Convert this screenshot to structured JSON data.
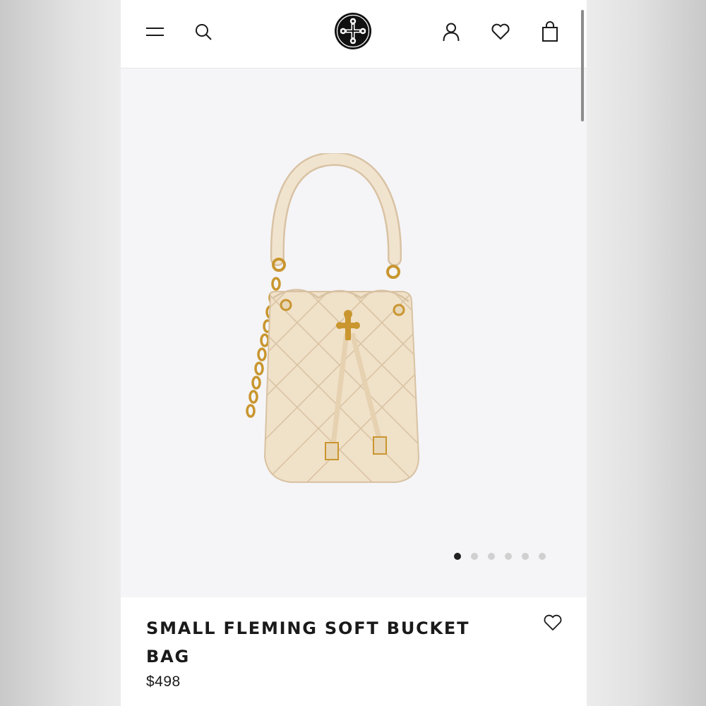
{
  "header": {
    "icons": {
      "menu": "hamburger-menu-icon",
      "search": "search-icon",
      "logo": "tory-burch-logo",
      "account": "account-icon",
      "wishlist": "heart-icon",
      "bag": "shopping-bag-icon"
    }
  },
  "gallery": {
    "image": "cream quilted leather bucket bag with gold chain strap",
    "slide_count": 6,
    "active_slide": 1
  },
  "product": {
    "title": "SMALL FLEMING SOFT BUCKET BAG",
    "price": "$498",
    "favorite_icon": "heart-outline-icon"
  },
  "colors": {
    "text": "#1a1a1a",
    "gallery_bg": "#f5f5f7",
    "bag_leather": "#f0e1c9",
    "hardware_gold": "#c9962f",
    "dot_active": "#222222",
    "dot_inactive": "#d0d0d0"
  }
}
